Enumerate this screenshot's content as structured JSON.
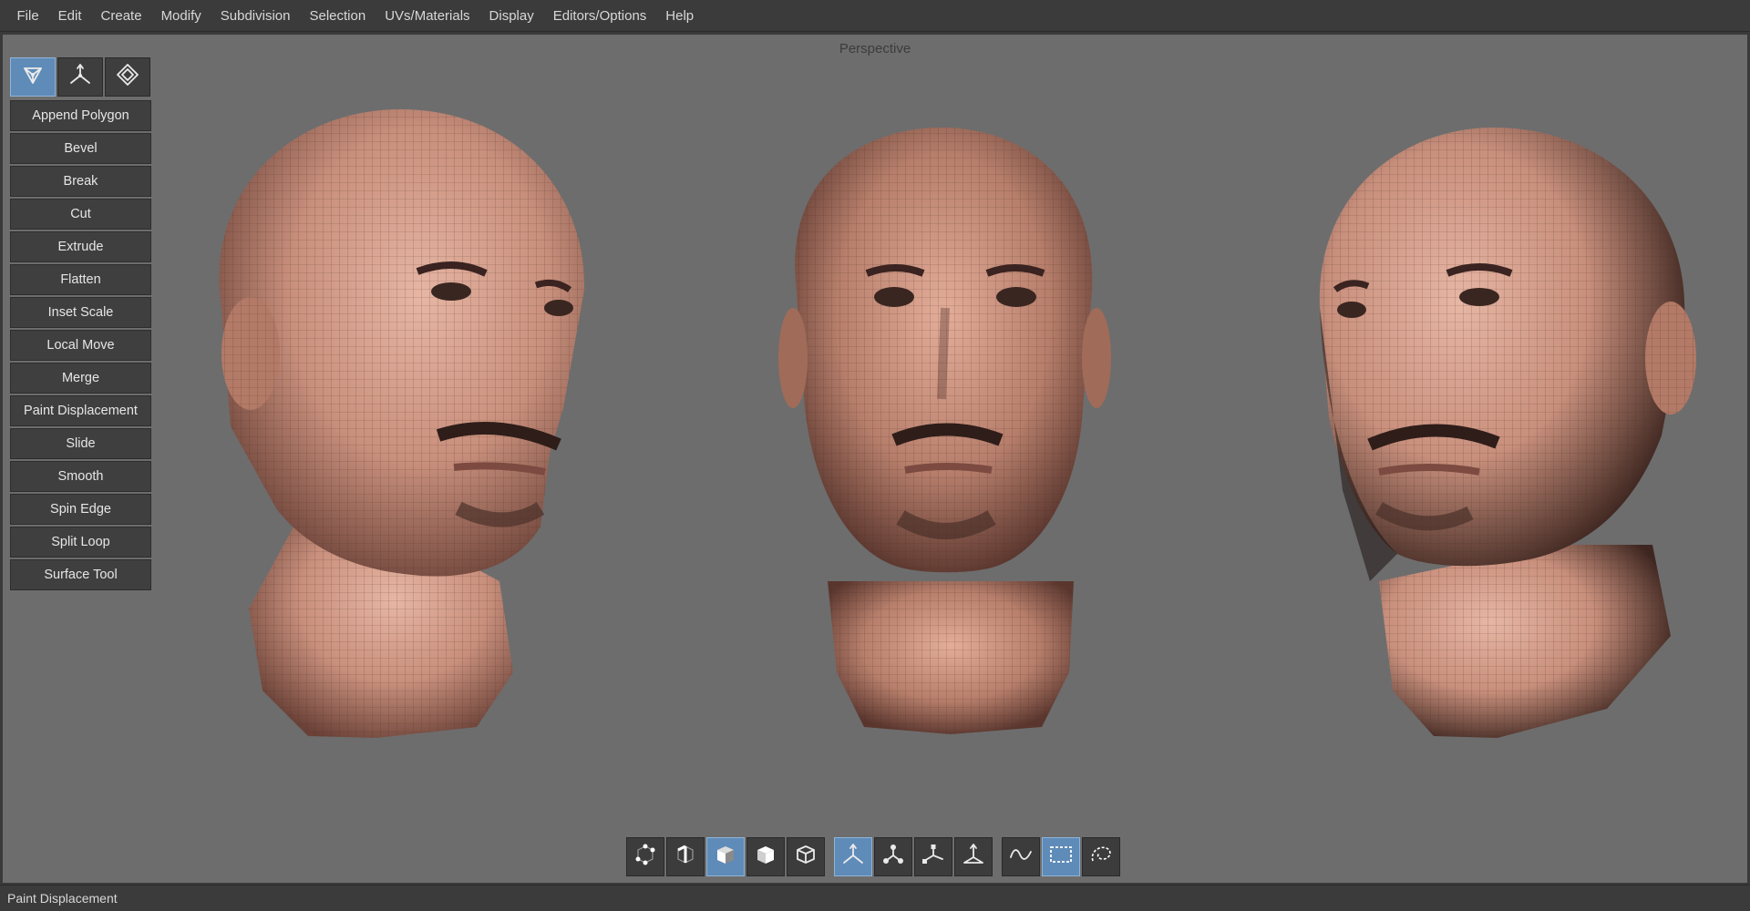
{
  "menu": [
    "File",
    "Edit",
    "Create",
    "Modify",
    "Subdivision",
    "Selection",
    "UVs/Materials",
    "Display",
    "Editors/Options",
    "Help"
  ],
  "viewport": {
    "title": "Perspective"
  },
  "mode_buttons": [
    {
      "icon": "polygon-mode-icon",
      "active": true
    },
    {
      "icon": "transform-mode-icon",
      "active": false
    },
    {
      "icon": "uv-mode-icon",
      "active": false
    }
  ],
  "tools": [
    "Append Polygon",
    "Bevel",
    "Break",
    "Cut",
    "Extrude",
    "Flatten",
    "Inset Scale",
    "Local Move",
    "Merge",
    "Paint Displacement",
    "Slide",
    "Smooth",
    "Spin Edge",
    "Split Loop",
    "Surface Tool"
  ],
  "toolbar_groups": [
    [
      {
        "icon": "vertex-select-icon",
        "active": false
      },
      {
        "icon": "edge-select-icon",
        "active": false
      },
      {
        "icon": "face-select-icon",
        "active": true
      },
      {
        "icon": "object-select-icon",
        "active": false
      },
      {
        "icon": "mesh-select-icon",
        "active": false
      }
    ],
    [
      {
        "icon": "move-gizmo-icon",
        "active": true
      },
      {
        "icon": "rotate-gizmo-icon",
        "active": false
      },
      {
        "icon": "scale-gizmo-icon",
        "active": false
      },
      {
        "icon": "universal-gizmo-icon",
        "active": false
      }
    ],
    [
      {
        "icon": "lasso-select-icon",
        "active": false
      },
      {
        "icon": "rect-select-icon",
        "active": true
      },
      {
        "icon": "freehand-select-icon",
        "active": false
      }
    ]
  ],
  "status": {
    "text": "Paint Displacement"
  },
  "colors": {
    "accent": "#5f8bb8",
    "viewport_bg": "#6d6d6d",
    "panel": "#3f3f3f",
    "skin": "#c88f7c"
  }
}
